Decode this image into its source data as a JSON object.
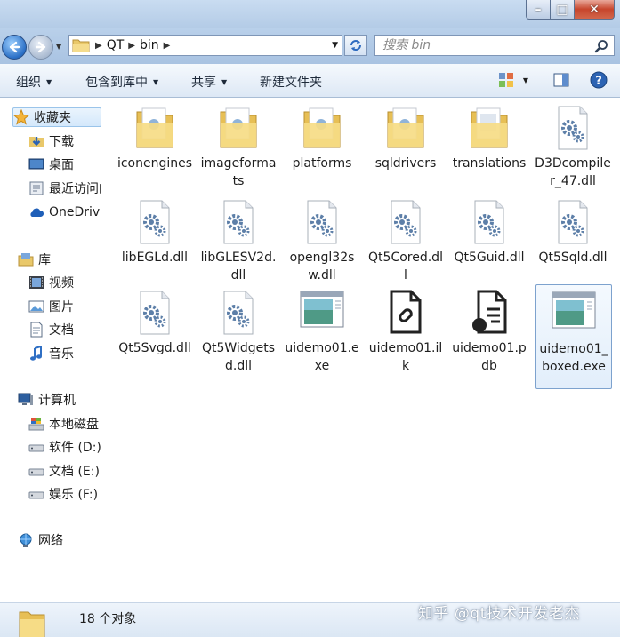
{
  "address": {
    "crumbs": [
      "QT",
      "bin"
    ],
    "search_placeholder": "搜索 bin"
  },
  "toolbar": {
    "organize": "组织",
    "include_library": "包含到库中",
    "share": "共享",
    "new_folder": "新建文件夹"
  },
  "nav": {
    "favorites": "收藏夹",
    "downloads": "下载",
    "desktop": "桌面",
    "recent": "最近访问的位置",
    "onedrive": "OneDrive",
    "libraries": "库",
    "videos": "视频",
    "pictures": "图片",
    "documents": "文档",
    "music": "音乐",
    "computer": "计算机",
    "local_disk": "本地磁盘",
    "drive_d": "软件 (D:)",
    "drive_e": "文档 (E:)",
    "drive_f": "娱乐 (F:)",
    "network": "网络"
  },
  "files": [
    {
      "name": "iconengines",
      "type": "folder"
    },
    {
      "name": "imageformats",
      "type": "folder"
    },
    {
      "name": "platforms",
      "type": "folder"
    },
    {
      "name": "sqldrivers",
      "type": "folder"
    },
    {
      "name": "translations",
      "type": "folder"
    },
    {
      "name": "D3Dcompiler_47.dll",
      "type": "dll"
    },
    {
      "name": "libEGLd.dll",
      "type": "dll"
    },
    {
      "name": "libGLESV2d.dll",
      "type": "dll"
    },
    {
      "name": "opengl32sw.dll",
      "type": "dll"
    },
    {
      "name": "Qt5Cored.dll",
      "type": "dll"
    },
    {
      "name": "Qt5Guid.dll",
      "type": "dll"
    },
    {
      "name": "Qt5Sqld.dll",
      "type": "dll"
    },
    {
      "name": "Qt5Svgd.dll",
      "type": "dll"
    },
    {
      "name": "Qt5Widgetsd.dll",
      "type": "dll"
    },
    {
      "name": "uidemo01.exe",
      "type": "exe"
    },
    {
      "name": "uidemo01.ilk",
      "type": "ilk"
    },
    {
      "name": "uidemo01.pdb",
      "type": "pdb"
    },
    {
      "name": "uidemo01_boxed.exe",
      "type": "exe",
      "selected": true
    }
  ],
  "status": {
    "count": "18 个对象"
  },
  "watermark": "知乎 @qt技术开发老杰"
}
